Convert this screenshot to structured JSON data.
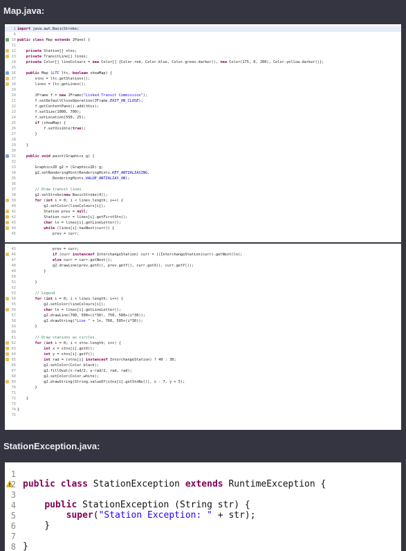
{
  "file1": {
    "title": "Map.java:",
    "lines_a": [
      {
        "n": "1",
        "m": "",
        "t": "import java.awt.BasicStroke;"
      },
      {
        "n": "6",
        "m": "",
        "t": ""
      },
      {
        "n": "10",
        "m": "g",
        "t": "public class Map extends JPanel {"
      },
      {
        "n": "11",
        "m": "",
        "t": ""
      },
      {
        "n": "12",
        "m": "y",
        "t": "    private Station[] stns;"
      },
      {
        "n": "13",
        "m": "y",
        "t": "    private TransitLine[] lines;"
      },
      {
        "n": "14",
        "m": "",
        "t": "    private Color[] lineColours = new Color[] {Color.red, Color.blue, Color.green.darker(), new Color(175, 0, 200), Color.yellow.darker()};"
      },
      {
        "n": "15",
        "m": "",
        "t": ""
      },
      {
        "n": "16",
        "m": "b",
        "t": "    public Map (LTC ltc, boolean showMap) {"
      },
      {
        "n": "17",
        "m": "y",
        "t": "        stns = ltc.getStations();"
      },
      {
        "n": "18",
        "m": "y",
        "t": "        lines = ltc.getLines();"
      },
      {
        "n": "19",
        "m": "",
        "t": ""
      },
      {
        "n": "20",
        "m": "",
        "t": "        JFrame f = new JFrame(\"Linked Transit Commission\");"
      },
      {
        "n": "21",
        "m": "",
        "t": "        f.setDefaultCloseOperation(JFrame.EXIT_ON_CLOSE);"
      },
      {
        "n": "22",
        "m": "",
        "t": "        f.getContentPane().add(this);"
      },
      {
        "n": "23",
        "m": "",
        "t": "        f.setSize(1000, 700);"
      },
      {
        "n": "24",
        "m": "",
        "t": "        f.setLocation(550, 25);"
      },
      {
        "n": "25",
        "m": "",
        "t": "        if (showMap) {"
      },
      {
        "n": "26",
        "m": "",
        "t": "            f.setVisible(true);"
      },
      {
        "n": "27",
        "m": "",
        "t": "        }"
      },
      {
        "n": "28",
        "m": "",
        "t": ""
      },
      {
        "n": "29",
        "m": "",
        "t": "    }"
      },
      {
        "n": "30",
        "m": "",
        "t": ""
      },
      {
        "n": "31",
        "m": "b",
        "t": "    public void paint(Graphics g) {"
      },
      {
        "n": "32",
        "m": "",
        "t": ""
      },
      {
        "n": "33",
        "m": "",
        "t": "        Graphics2D g2 = (Graphics2D) g;"
      },
      {
        "n": "34",
        "m": "",
        "t": "        g2.setRenderingHint(RenderingHints.KEY_ANTIALIASING,"
      },
      {
        "n": "35",
        "m": "",
        "t": "                RenderingHints.VALUE_ANTIALIAS_ON);"
      },
      {
        "n": "36",
        "m": "",
        "t": ""
      },
      {
        "n": "37",
        "m": "",
        "t": "        // Draw transit lines"
      },
      {
        "n": "38",
        "m": "",
        "t": "        g2.setStroke(new BasicStroke(4));"
      },
      {
        "n": "39",
        "m": "y",
        "t": "        for (int i = 0; i < lines.length; i++) {"
      },
      {
        "n": "40",
        "m": "",
        "t": "            g2.setColor(lineColours[i]);"
      },
      {
        "n": "41",
        "m": "y",
        "t": "            Station prev = null;"
      },
      {
        "n": "42",
        "m": "y",
        "t": "            Station curr = lines[i].getFirstStn();"
      },
      {
        "n": "43",
        "m": "y",
        "t": "            char ln = lines[i].getLineLetter();"
      },
      {
        "n": "44",
        "m": "y",
        "t": "            while (lines[i].hasNext(curr)) {"
      },
      {
        "n": "45",
        "m": "",
        "t": "                prev = curr;"
      }
    ],
    "lines_b": [
      {
        "n": "45",
        "m": "",
        "t": "                prev = curr;"
      },
      {
        "n": "46",
        "m": "y",
        "t": "                if (curr instanceof InterchangeStation) curr = ((InterchangeStation)curr).getNext(ln);"
      },
      {
        "n": "47",
        "m": "",
        "t": "                else curr = curr.getNext();"
      },
      {
        "n": "48",
        "m": "",
        "t": "                g2.drawLine(prev.getX(), prev.getY(), curr.getX(), curr.getY());"
      },
      {
        "n": "49",
        "m": "",
        "t": "            }"
      },
      {
        "n": "50",
        "m": "",
        "t": ""
      },
      {
        "n": "51",
        "m": "",
        "t": "        }"
      },
      {
        "n": "52",
        "m": "",
        "t": ""
      },
      {
        "n": "53",
        "m": "",
        "t": "        // Legend"
      },
      {
        "n": "54",
        "m": "y",
        "t": "        for (int i = 0; i < lines.length; i++) {"
      },
      {
        "n": "55",
        "m": "",
        "t": "            g2.setColor(lineColours[i]);"
      },
      {
        "n": "56",
        "m": "y",
        "t": "            char ln = lines[i].getLineLetter();"
      },
      {
        "n": "57",
        "m": "",
        "t": "            g2.drawLine(700, 500+(i*30), 750, 500+(i*30));"
      },
      {
        "n": "58",
        "m": "",
        "t": "            g2.drawString(\"Line \" + ln, 760, 505+(i*30));"
      },
      {
        "n": "59",
        "m": "",
        "t": "        }"
      },
      {
        "n": "60",
        "m": "",
        "t": ""
      },
      {
        "n": "61",
        "m": "",
        "t": "        // Draw stations as circles."
      },
      {
        "n": "62",
        "m": "y",
        "t": "        for (int i = 0; i < stns.length; i++) {"
      },
      {
        "n": "63",
        "m": "y",
        "t": "            int x = stns[i].getX();"
      },
      {
        "n": "64",
        "m": "y",
        "t": "            int y = stns[i].getY();"
      },
      {
        "n": "65",
        "m": "y",
        "t": "            int rad = (stns[i] instanceof InterchangeStation) ? 40 : 30;"
      },
      {
        "n": "66",
        "m": "",
        "t": "            g2.setColor(Color.black);"
      },
      {
        "n": "67",
        "m": "",
        "t": "            g2.fillOval(x-rad/2, y-rad/2, rad, rad);"
      },
      {
        "n": "68",
        "m": "",
        "t": "            g2.setColor(Color.white);"
      },
      {
        "n": "69",
        "m": "y",
        "t": "            g2.drawString(String.valueOf(stns[i].getStnNo()), x - 7, y + 5);"
      },
      {
        "n": "70",
        "m": "",
        "t": "        }"
      },
      {
        "n": "71",
        "m": "",
        "t": ""
      },
      {
        "n": "72",
        "m": "",
        "t": "    }"
      },
      {
        "n": "73",
        "m": "",
        "t": ""
      },
      {
        "n": "74",
        "m": "",
        "t": "}"
      },
      {
        "n": "75",
        "m": "",
        "t": ""
      }
    ]
  },
  "file2": {
    "title": "StationException.java:",
    "lines": [
      {
        "n": "1",
        "t": "",
        "w": false
      },
      {
        "n": "2",
        "t": "public class StationException extends RuntimeException {",
        "w": true
      },
      {
        "n": "3",
        "t": "",
        "w": false
      },
      {
        "n": "4",
        "t": "    public StationException (String str) {",
        "w": false
      },
      {
        "n": "5",
        "t": "        super(\"Station Exception: \" + str);",
        "w": false
      },
      {
        "n": "6",
        "t": "    }",
        "w": false
      },
      {
        "n": "7",
        "t": "",
        "w": false
      },
      {
        "n": "8",
        "t": "}",
        "w": false
      }
    ]
  },
  "colors": {
    "background": "#343541",
    "panel": "#ffffff",
    "keyword": "#7f0055",
    "string": "#2a00ff",
    "comment": "#3f7f5f",
    "field": "#0000c0"
  }
}
